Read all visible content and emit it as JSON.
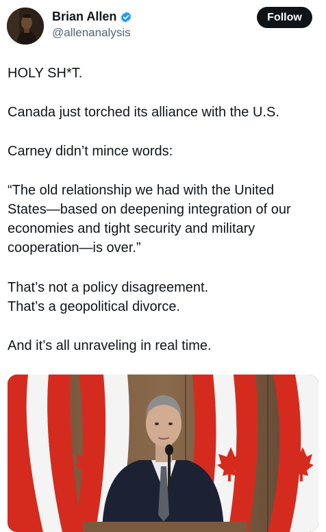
{
  "post": {
    "author": {
      "display_name": "Brian Allen",
      "handle": "@allenanalysis",
      "verified": true,
      "avatar_icon": "profile-photo"
    },
    "follow_label": "Follow",
    "lines": [
      "HOLY SH*T.",
      "Canada just torched its alliance with the U.S.",
      "Carney didn’t mince words:",
      "“The old relationship we had with the United",
      "States—based on deepening integration of our",
      "economies and tight security and military",
      "cooperation—is over.”",
      "That’s not a policy disagreement.",
      "That’s a geopolitical divorce.",
      "And it’s all unraveling in real time."
    ],
    "media": {
      "icon": "photo-speaker-with-canadian-flags"
    }
  },
  "colors": {
    "text": "#0f1419",
    "secondary_text": "#536471",
    "verified_badge": "#1d9bf0",
    "follow_button": "#0f1419",
    "flag_red": "#d52b1e"
  }
}
